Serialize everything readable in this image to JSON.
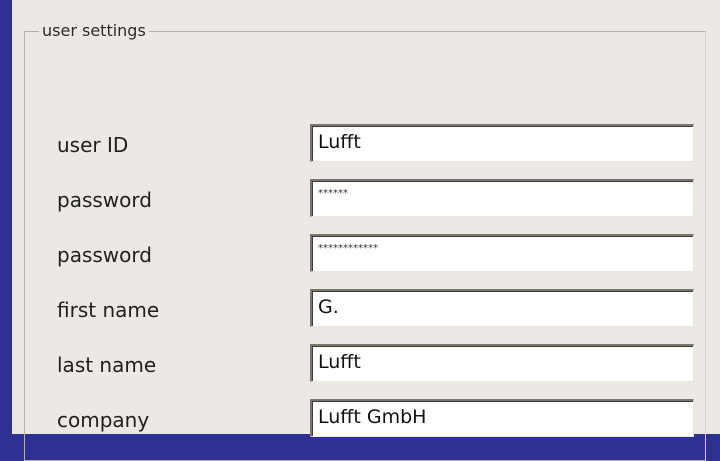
{
  "group": {
    "title": "user settings"
  },
  "fields": [
    {
      "label": "user ID",
      "value": "Lufft"
    },
    {
      "label": "password",
      "value": "******"
    },
    {
      "label": "password",
      "value": "************"
    },
    {
      "label": "first name",
      "value": "G."
    },
    {
      "label": "last name",
      "value": "Lufft"
    },
    {
      "label": "company",
      "value": "Lufft GmbH"
    }
  ]
}
